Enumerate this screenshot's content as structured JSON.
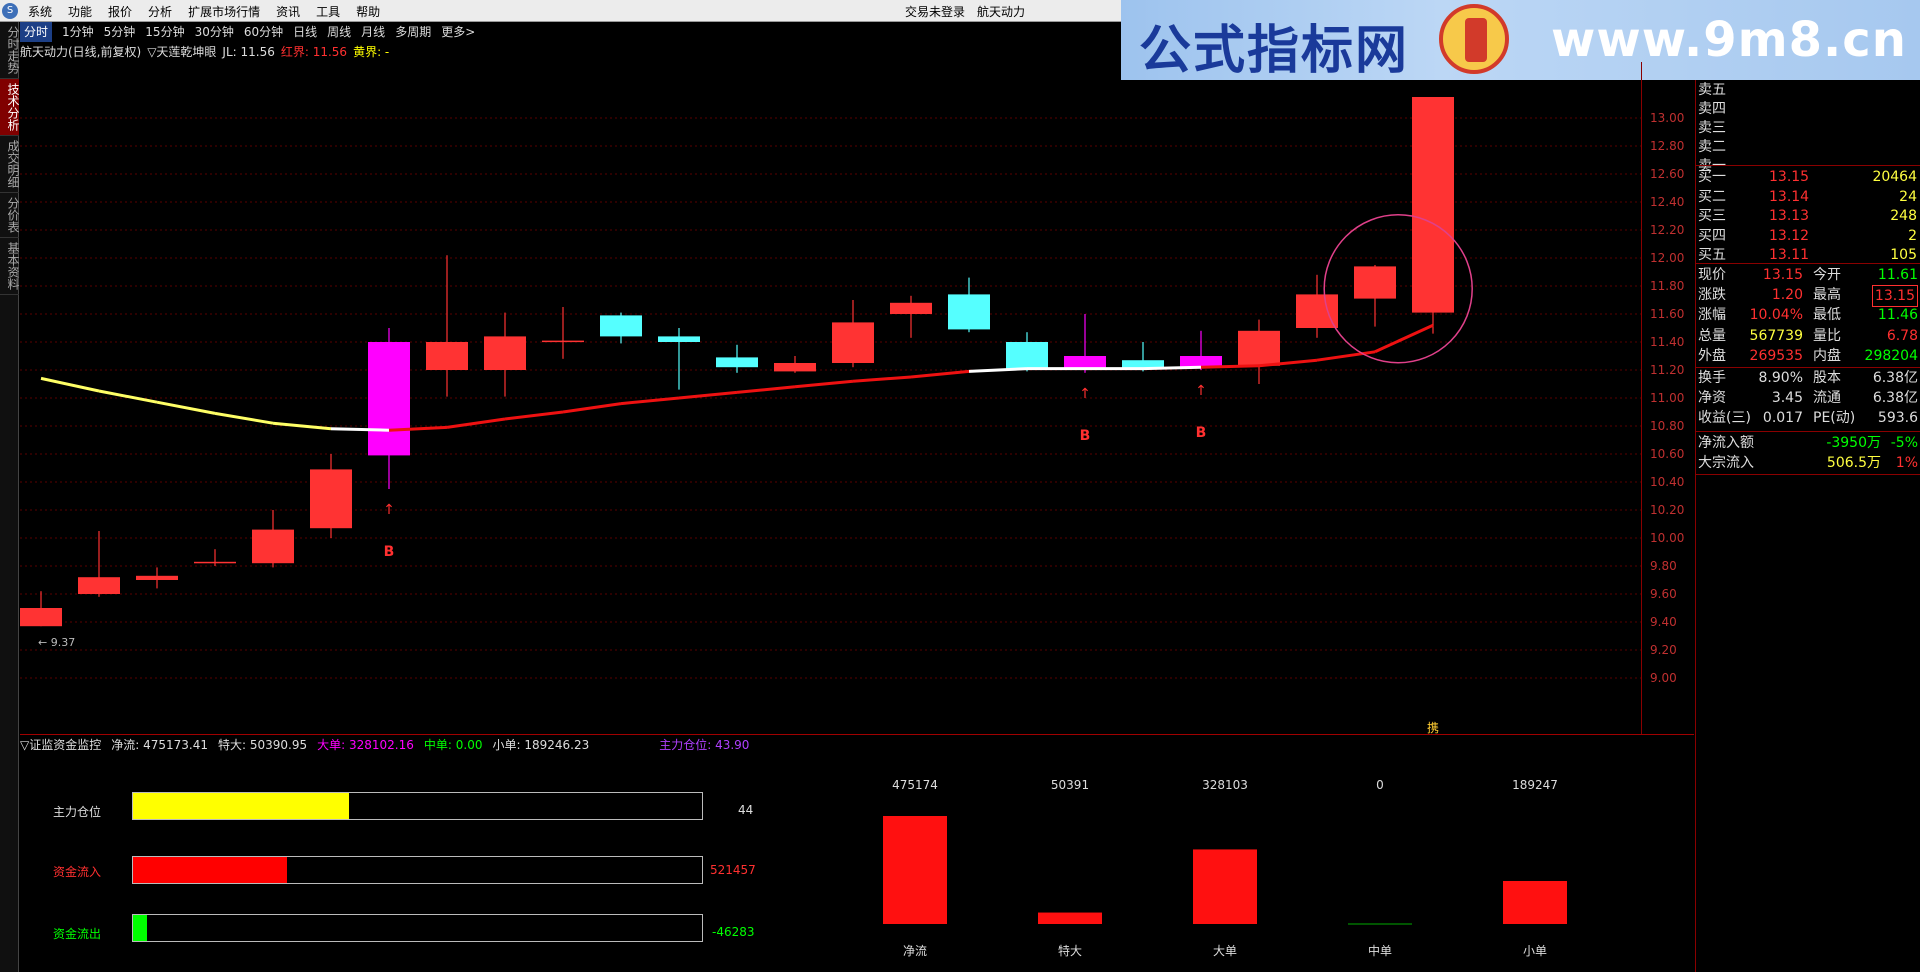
{
  "menubar": {
    "items": [
      "系统",
      "功能",
      "报价",
      "分析",
      "扩展市场行情",
      "资讯",
      "工具",
      "帮助"
    ],
    "status": "交易未登录",
    "stock": "航天动力"
  },
  "banner": {
    "site_cn": "公式指标网",
    "site_url": "www.9m8.cn"
  },
  "sidetabs": [
    "分时走势",
    "技术分析",
    "成交明细",
    "分价表",
    "基本资料"
  ],
  "periods": [
    "分时",
    "1分钟",
    "5分钟",
    "15分钟",
    "30分钟",
    "60分钟",
    "日线",
    "周线",
    "月线",
    "多周期",
    "更多>"
  ],
  "title": {
    "stock": "航天动力(日线,前复权)",
    "indicator": "▽天莲乾坤眼",
    "jl": "JL: 11.56",
    "red": "红界: 11.56",
    "yellow": "黄界: -"
  },
  "main_chart": {
    "type": "candlestick",
    "ylim": [
      9.0,
      13.0
    ],
    "ticks": [
      "13.00",
      "12.80",
      "12.60",
      "12.40",
      "12.20",
      "12.00",
      "11.80",
      "11.60",
      "11.40",
      "11.20",
      "11.00",
      "10.80",
      "10.60",
      "10.40",
      "10.20",
      "10.00",
      "9.80",
      "9.60",
      "9.40",
      "9.20",
      "9.00"
    ],
    "low_label": "← 9.37",
    "candles": [
      {
        "o": 9.37,
        "c": 9.5,
        "h": 9.62,
        "l": 9.37,
        "col": "red"
      },
      {
        "o": 9.6,
        "c": 9.72,
        "h": 10.05,
        "l": 9.58,
        "col": "red"
      },
      {
        "o": 9.7,
        "c": 9.73,
        "h": 9.79,
        "l": 9.64,
        "col": "red"
      },
      {
        "o": 9.82,
        "c": 9.83,
        "h": 9.92,
        "l": 9.8,
        "col": "red"
      },
      {
        "o": 9.82,
        "c": 10.06,
        "h": 10.2,
        "l": 9.79,
        "col": "red"
      },
      {
        "o": 10.07,
        "c": 10.49,
        "h": 10.6,
        "l": 10.0,
        "col": "red"
      },
      {
        "o": 10.59,
        "c": 11.4,
        "h": 11.5,
        "l": 10.35,
        "col": "magenta"
      },
      {
        "o": 11.2,
        "c": 11.4,
        "h": 12.02,
        "l": 11.01,
        "col": "red"
      },
      {
        "o": 11.2,
        "c": 11.44,
        "h": 11.61,
        "l": 11.01,
        "col": "red"
      },
      {
        "o": 11.4,
        "c": 11.41,
        "h": 11.65,
        "l": 11.28,
        "col": "red"
      },
      {
        "o": 11.59,
        "c": 11.44,
        "h": 11.61,
        "l": 11.39,
        "col": "cyan"
      },
      {
        "o": 11.44,
        "c": 11.4,
        "h": 11.5,
        "l": 11.06,
        "col": "cyan"
      },
      {
        "o": 11.29,
        "c": 11.22,
        "h": 11.38,
        "l": 11.18,
        "col": "cyan"
      },
      {
        "o": 11.19,
        "c": 11.25,
        "h": 11.3,
        "l": 11.18,
        "col": "red"
      },
      {
        "o": 11.25,
        "c": 11.54,
        "h": 11.7,
        "l": 11.22,
        "col": "red"
      },
      {
        "o": 11.6,
        "c": 11.68,
        "h": 11.73,
        "l": 11.43,
        "col": "red"
      },
      {
        "o": 11.74,
        "c": 11.49,
        "h": 11.86,
        "l": 11.47,
        "col": "cyan"
      },
      {
        "o": 11.4,
        "c": 11.21,
        "h": 11.47,
        "l": 11.19,
        "col": "cyan"
      },
      {
        "o": 11.21,
        "c": 11.3,
        "h": 11.6,
        "l": 11.18,
        "col": "magenta"
      },
      {
        "o": 11.27,
        "c": 11.21,
        "h": 11.4,
        "l": 11.19,
        "col": "cyan"
      },
      {
        "o": 11.22,
        "c": 11.3,
        "h": 11.48,
        "l": 11.2,
        "col": "magenta"
      },
      {
        "o": 11.23,
        "c": 11.48,
        "h": 11.56,
        "l": 11.1,
        "col": "red"
      },
      {
        "o": 11.5,
        "c": 11.74,
        "h": 11.88,
        "l": 11.43,
        "col": "red"
      },
      {
        "o": 11.71,
        "c": 11.94,
        "h": 11.95,
        "l": 11.51,
        "col": "red"
      },
      {
        "o": 11.61,
        "c": 13.15,
        "h": 13.15,
        "l": 11.46,
        "col": "red"
      }
    ],
    "line": [
      11.14,
      11.05,
      10.97,
      10.89,
      10.82,
      10.78,
      10.77,
      10.79,
      10.85,
      10.9,
      10.96,
      11.0,
      11.04,
      11.08,
      11.12,
      11.15,
      11.19,
      11.21,
      11.21,
      11.21,
      11.22,
      11.23,
      11.27,
      11.33,
      11.52
    ],
    "buy_signals": [
      {
        "i": 6,
        "label": "B"
      },
      {
        "i": 18,
        "label": "B"
      },
      {
        "i": 20,
        "label": "B"
      }
    ],
    "bottom_mark": "携"
  },
  "monitor": {
    "name": "▽证监资金监控",
    "jingliu": "净流: 475173.41",
    "teda": "特大: 50390.95",
    "dadan": "大单: 328102.16",
    "zhongdan": "中单: 0.00",
    "xiaodan": "小单: 189246.23",
    "zhuli": "主力仓位: 43.90"
  },
  "bars": [
    {
      "label": "主力仓位",
      "value": "44",
      "fraction": 0.38,
      "color": "#ffff00",
      "label_color": "#ddd"
    },
    {
      "label": "资金流入",
      "value": "521457",
      "fraction": 0.27,
      "color": "#ff0000",
      "label_color": "#ff3030"
    },
    {
      "label": "资金流出",
      "value": "-46283",
      "fraction": 0.025,
      "color": "#00ff00",
      "label_color": "#00ff00"
    }
  ],
  "money_chart": {
    "type": "bar",
    "categories": [
      "净流",
      "特大",
      "大单",
      "中单",
      "小单"
    ],
    "values": [
      475174,
      50391,
      328103,
      0,
      189247
    ],
    "labels": [
      "475174",
      "50391",
      "328103",
      "0",
      "189247"
    ]
  },
  "quote": {
    "sell_labels": [
      "卖五",
      "卖四",
      "卖三",
      "卖二",
      "卖一"
    ],
    "buy": [
      {
        "label": "买一",
        "price": "13.15",
        "vol": "20464"
      },
      {
        "label": "买二",
        "price": "13.14",
        "vol": "24"
      },
      {
        "label": "买三",
        "price": "13.13",
        "vol": "248"
      },
      {
        "label": "买四",
        "price": "13.12",
        "vol": "2"
      },
      {
        "label": "买五",
        "price": "13.11",
        "vol": "105"
      }
    ],
    "stats": [
      {
        "k1": "现价",
        "v1": "13.15",
        "c1": "red",
        "k2": "今开",
        "v2": "11.61",
        "c2": "grn"
      },
      {
        "k1": "涨跌",
        "v1": "1.20",
        "c1": "red",
        "k2": "最高",
        "v2": "13.15",
        "c2": "red"
      },
      {
        "k1": "涨幅",
        "v1": "10.04%",
        "c1": "red",
        "k2": "最低",
        "v2": "11.46",
        "c2": "grn"
      },
      {
        "k1": "总量",
        "v1": "567739",
        "c1": "yel",
        "k2": "量比",
        "v2": "6.78",
        "c2": "red"
      },
      {
        "k1": "外盘",
        "v1": "269535",
        "c1": "red",
        "k2": "内盘",
        "v2": "298204",
        "c2": "grn"
      },
      {
        "k1": "换手",
        "v1": "8.90%",
        "c1": "wht",
        "k2": "股本",
        "v2": "6.38亿",
        "c2": "wht"
      },
      {
        "k1": "净资",
        "v1": "3.45",
        "c1": "wht",
        "k2": "流通",
        "v2": "6.38亿",
        "c2": "wht"
      },
      {
        "k1": "收益(三)",
        "v1": "0.017",
        "c1": "wht",
        "k2": "PE(动)",
        "v2": "593.6",
        "c2": "wht"
      }
    ],
    "flow": [
      {
        "k": "净流入额",
        "v": "-3950万",
        "c": "grn",
        "p": "-5%",
        "pc": "grn"
      },
      {
        "k": "大宗流入",
        "v": "506.5万",
        "c": "yel",
        "p": "1%",
        "pc": "red"
      }
    ]
  }
}
